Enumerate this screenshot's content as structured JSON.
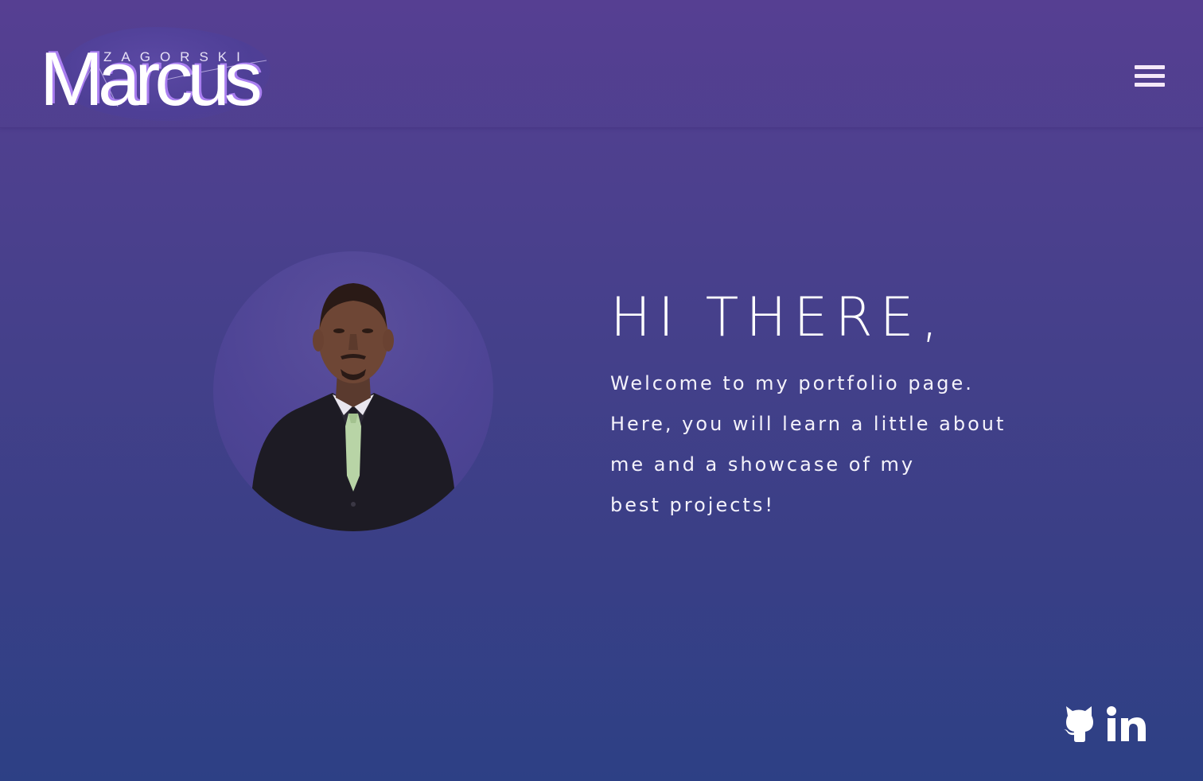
{
  "header": {
    "logo": {
      "subtitle": "ZAGORSKI",
      "title": "Marcus"
    },
    "menu_icon": "hamburger-menu-icon"
  },
  "hero": {
    "greeting": "HI THERE,",
    "intro_lines": [
      "Welcome to my portfolio page.",
      "Here, you will learn a little about",
      "me and a showcase of my",
      "best projects!"
    ],
    "avatar_alt": "profile-photo"
  },
  "social": {
    "github_icon": "github-icon",
    "linkedin_icon": "linkedin-icon"
  },
  "colors": {
    "background_top": "#563f92",
    "background_bottom": "#2d4085",
    "logo_accent": "#a97ef0",
    "text": "#ffffff"
  }
}
